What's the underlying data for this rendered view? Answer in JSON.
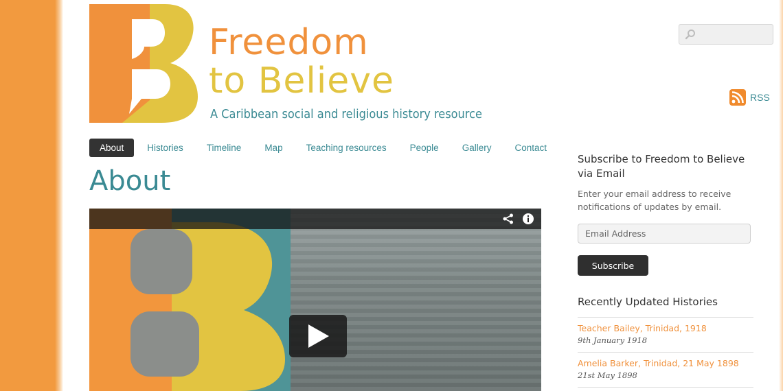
{
  "logo": {
    "title_line1": "Freedom",
    "title_line2": "to Believe",
    "subtitle": "A Caribbean social and religious history resource",
    "icon": "fb-logo-icon"
  },
  "search": {
    "placeholder": "",
    "icon": "search-icon"
  },
  "rss": {
    "label": "RSS",
    "icon": "rss-icon"
  },
  "nav": {
    "items": [
      {
        "label": "About",
        "active": true
      },
      {
        "label": "Histories"
      },
      {
        "label": "Timeline"
      },
      {
        "label": "Map"
      },
      {
        "label": "Teaching resources"
      },
      {
        "label": "People"
      },
      {
        "label": "Gallery"
      },
      {
        "label": "Contact"
      }
    ]
  },
  "page": {
    "title": "About"
  },
  "video": {
    "icons": [
      "share-icon",
      "info-icon",
      "play-icon"
    ]
  },
  "sidebar": {
    "subscribe": {
      "title": "Subscribe to Freedom to Believe via Email",
      "description": "Enter your email address to receive notifications of updates by email.",
      "email_placeholder": "Email Address",
      "button_label": "Subscribe"
    },
    "recent": {
      "title": "Recently Updated Histories",
      "items": [
        {
          "title": "Teacher Bailey, Trinidad, 1918",
          "date": "9th January 1918"
        },
        {
          "title": "Amelia Barker, Trinidad, 21 May 1898",
          "date": "21st May 1898"
        }
      ]
    }
  },
  "colors": {
    "brand_orange": "#f0913c",
    "brand_yellow": "#e2c441",
    "brand_teal": "#3a8a93",
    "dark": "#333333"
  }
}
